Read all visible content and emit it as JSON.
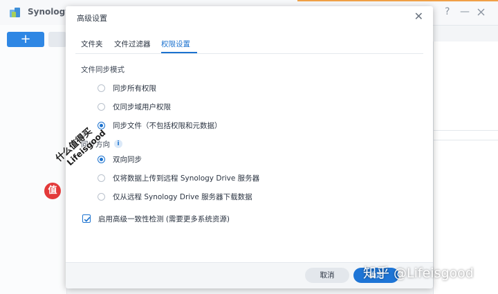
{
  "background": {
    "app_title": "Synology",
    "add_button": "+",
    "help_icon": "?",
    "minimize_icon": "—",
    "colors": {
      "accent": "#f0a047",
      "primary": "#2f87e4"
    }
  },
  "dialog": {
    "title": "高级设置",
    "close_symbol": "✕",
    "tabs": [
      {
        "label": "文件夹",
        "active": false
      },
      {
        "label": "文件过滤器",
        "active": false
      },
      {
        "label": "权限设置",
        "active": true
      }
    ],
    "sync_mode": {
      "label": "文件同步模式",
      "options": [
        {
          "label": "同步所有权限",
          "selected": false
        },
        {
          "label": "仅同步域用户权限",
          "selected": false
        },
        {
          "label": "同步文件（不包括权限和元数据）",
          "selected": true
        }
      ]
    },
    "sync_direction": {
      "label": "同步方向",
      "info_symbol": "i",
      "options": [
        {
          "label": "双向同步",
          "selected": true
        },
        {
          "label": "仅将数据上传到远程 Synology Drive 服务器",
          "selected": false
        },
        {
          "label": "仅从远程 Synology Drive 服务器下载数据",
          "selected": false
        }
      ]
    },
    "advanced_check": {
      "label": "启用高级一致性检测 (需要更多系统资源)",
      "checked": true
    },
    "footer": {
      "cancel_label": "取消",
      "ok_label": "确定"
    },
    "colors": {
      "accent": "#1b72cf",
      "button_primary": "#1e75d6"
    }
  },
  "watermarks": {
    "badge": "值",
    "diag_line1": "什么值得买",
    "diag_line2": "Lifeisgood",
    "zhihu": "知乎 @Lifeisgood"
  }
}
